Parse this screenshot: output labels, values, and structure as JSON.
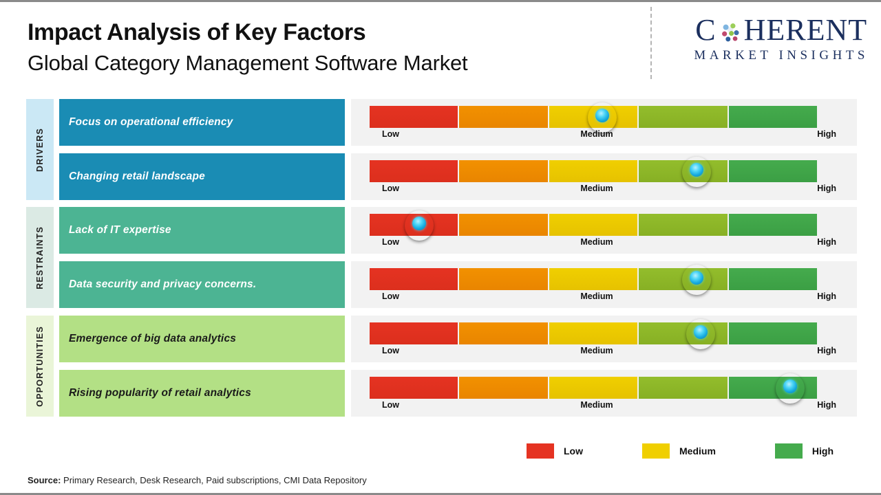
{
  "header": {
    "title": "Impact Analysis of Key Factors",
    "subtitle": "Global Category Management Software Market"
  },
  "logo": {
    "name_part1": "C",
    "name_part2": "HERENT",
    "tagline": "MARKET INSIGHTS",
    "globe_icon": "globe-icon"
  },
  "categories": [
    {
      "label": "DRIVERS",
      "color": "#cbe8f5"
    },
    {
      "label": "RESTRAINTS",
      "color": "#dbeae4"
    },
    {
      "label": "OPPORTUNITIES",
      "color": "#eaf5d8"
    }
  ],
  "scale": {
    "low": "Low",
    "medium": "Medium",
    "high": "High"
  },
  "legend": [
    {
      "label": "Low",
      "color": "#e53322"
    },
    {
      "label": "Medium",
      "color": "#f0cf00"
    },
    {
      "label": "High",
      "color": "#45ab4d"
    }
  ],
  "source": {
    "label": "Source:",
    "text": " Primary Research, Desk Research, Paid subscriptions, CMI Data Repository"
  },
  "chart_data": {
    "type": "bar",
    "title": "Impact Analysis of Key Factors",
    "subtitle": "Global Category Management Software Market",
    "xlabel": "",
    "ylabel": "",
    "scale_ticks": [
      "Low",
      "Medium",
      "High"
    ],
    "segments": [
      "#e53322",
      "#f29100",
      "#f0cf00",
      "#93bd2c",
      "#45ab4d"
    ],
    "legend_entries": [
      "Low",
      "Medium",
      "High"
    ],
    "categories": [
      "DRIVERS",
      "RESTRAINTS",
      "OPPORTUNITIES"
    ],
    "rows": [
      {
        "category": "DRIVERS",
        "factor": "Focus on operational efficiency",
        "impact": "Medium",
        "position_pct": 52,
        "bar_color": "#1a8cb4",
        "text_color": "#ffffff"
      },
      {
        "category": "DRIVERS",
        "factor": "Changing retail landscape",
        "impact": "Medium-High",
        "position_pct": 73,
        "bar_color": "#1a8cb4",
        "text_color": "#ffffff"
      },
      {
        "category": "RESTRAINTS",
        "factor": "Lack of IT expertise",
        "impact": "Low",
        "position_pct": 11,
        "bar_color": "#4cb493",
        "text_color": "#ffffff"
      },
      {
        "category": "RESTRAINTS",
        "factor": "Data security and privacy concerns.",
        "impact": "Medium-High",
        "position_pct": 73,
        "bar_color": "#4cb493",
        "text_color": "#ffffff"
      },
      {
        "category": "OPPORTUNITIES",
        "factor": "Emergence of big data analytics",
        "impact": "Medium-High",
        "position_pct": 74,
        "bar_color": "#b3e085",
        "text_color": "#1a1a1a"
      },
      {
        "category": "OPPORTUNITIES",
        "factor": "Rising popularity of retail analytics",
        "impact": "High",
        "position_pct": 94,
        "bar_color": "#b3e085",
        "text_color": "#1a1a1a"
      }
    ]
  }
}
